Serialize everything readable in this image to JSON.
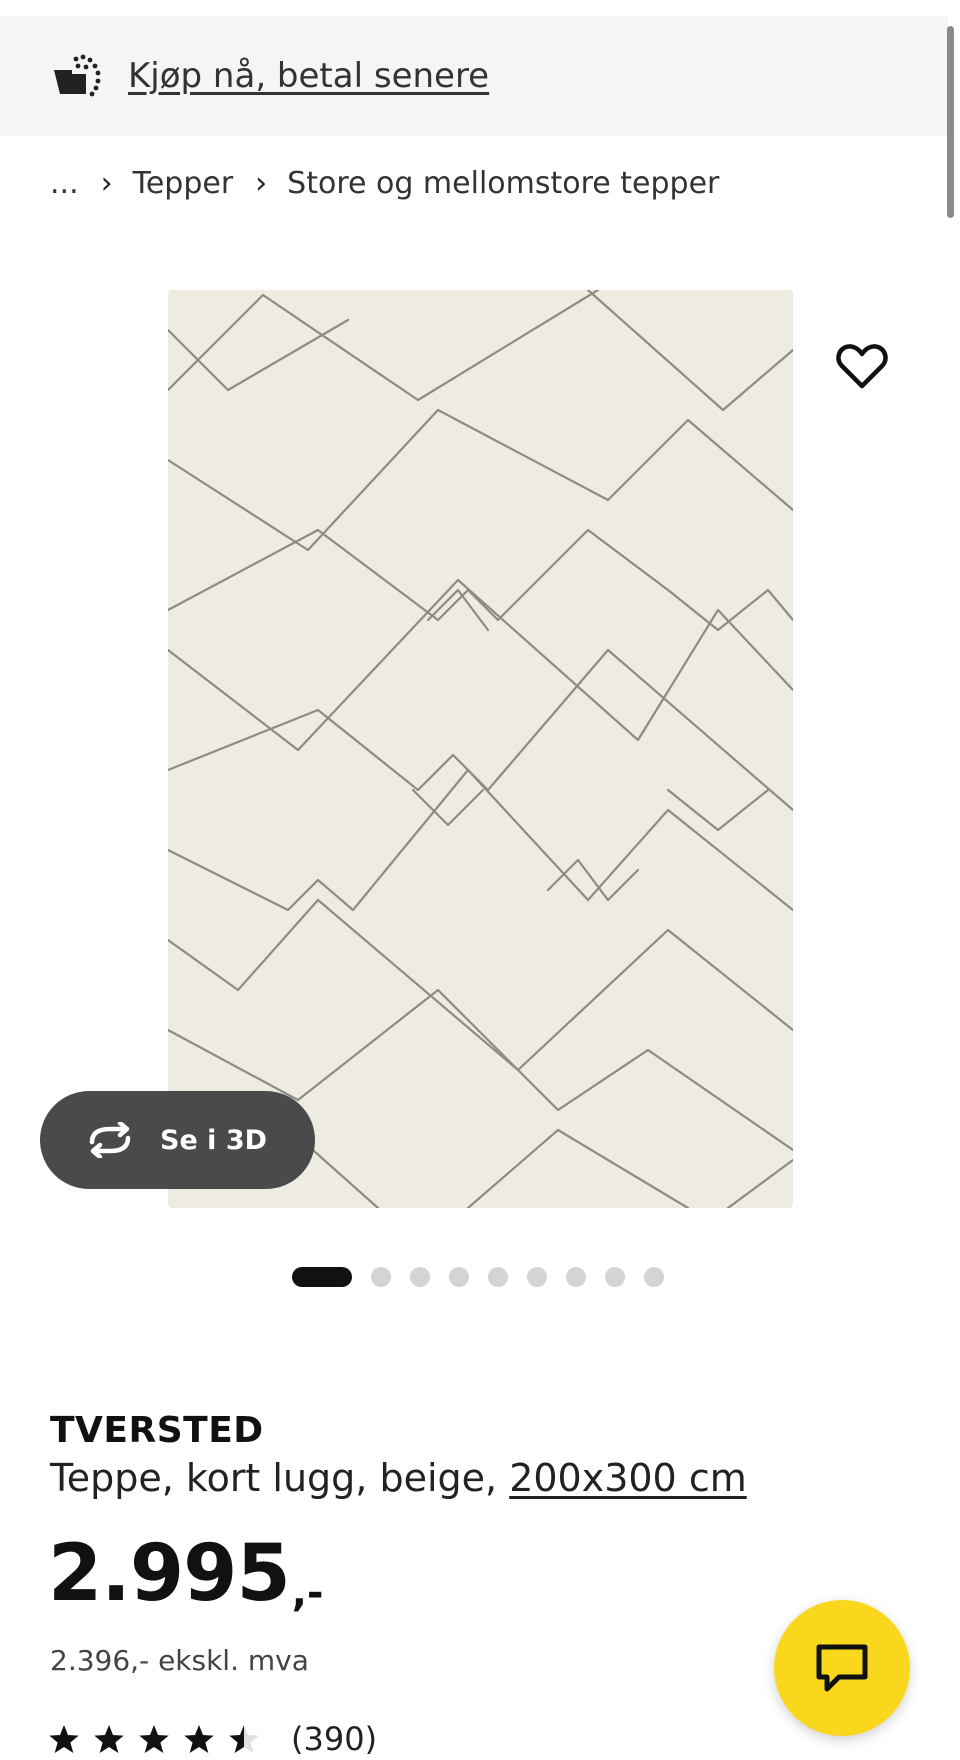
{
  "banner": {
    "icon": "buy-now-pay-later-icon",
    "link_text": "Kjøp nå, betal senere"
  },
  "breadcrumb": {
    "ellipsis": "...",
    "separator_icon": "chevron-right-icon",
    "items": [
      "Tepper",
      "Store og mellomstore tepper"
    ]
  },
  "gallery": {
    "image_alt": "Rug with geometric diamond line pattern",
    "favorite_icon": "heart-outline-icon",
    "view_3d_label": "Se i 3D",
    "view_3d_icon": "rotate-3d-icon",
    "slide_count": 9,
    "active_slide": 1
  },
  "product": {
    "name": "TVERSTED",
    "description": "Teppe, kort lugg, beige,",
    "size": "200x300 cm",
    "price_main": "2.995",
    "price_suffix": ",-",
    "price_ex_vat": "2.396,- ekskl. mva",
    "rating": 4.5,
    "rating_max": 5,
    "review_count": "(390)"
  },
  "chat": {
    "icon": "chat-bubble-icon"
  },
  "colors": {
    "accent_yellow": "#f8d71c",
    "rug_background": "#eeebe3",
    "rug_lines": "#8e8b85",
    "pill_background": "#4a4a4a"
  }
}
